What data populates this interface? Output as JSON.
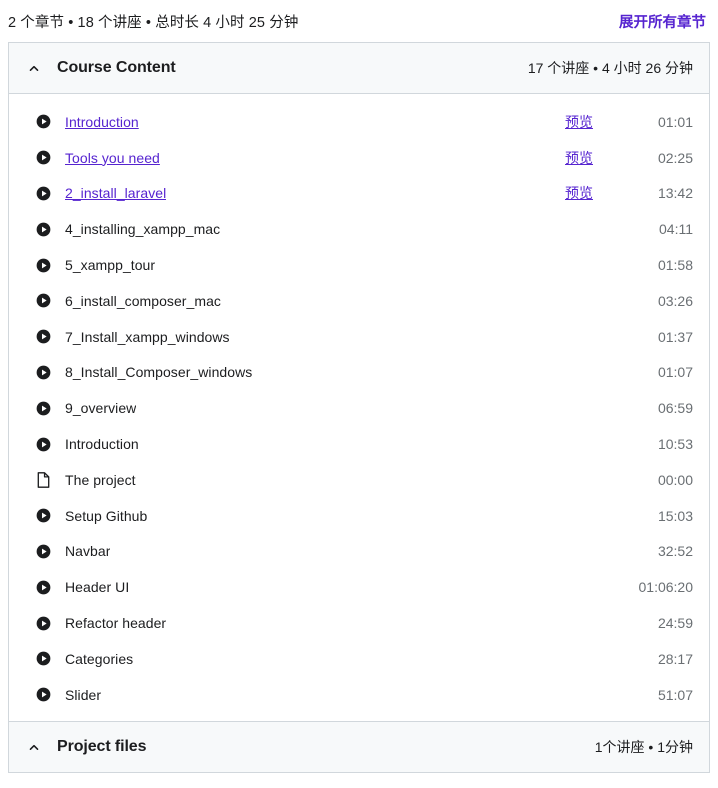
{
  "summary": {
    "text": "2 个章节 • 18 个讲座 • 总时长 4 小时 25 分钟",
    "expand_all_label": "展开所有章节"
  },
  "colors": {
    "link_purple": "#5624d0",
    "text_primary": "#1c1d1f",
    "text_muted": "#6a6f73",
    "header_bg": "#f7f9fa",
    "border": "#d1d7dc"
  },
  "sections": [
    {
      "title": "Course Content",
      "meta": "17 个讲座 • 4 小时 26 分钟",
      "expanded": true,
      "toggle_icon": "chevron-up-icon",
      "lectures": [
        {
          "title": "Introduction",
          "icon": "play-icon",
          "is_link": true,
          "preview": "预览",
          "duration": "01:01"
        },
        {
          "title": "Tools you need",
          "icon": "play-icon",
          "is_link": true,
          "preview": "预览",
          "duration": "02:25"
        },
        {
          "title": "2_install_laravel",
          "icon": "play-icon",
          "is_link": true,
          "preview": "预览",
          "duration": "13:42"
        },
        {
          "title": "4_installing_xampp_mac",
          "icon": "play-icon",
          "is_link": false,
          "preview": "",
          "duration": "04:11"
        },
        {
          "title": "5_xampp_tour",
          "icon": "play-icon",
          "is_link": false,
          "preview": "",
          "duration": "01:58"
        },
        {
          "title": "6_install_composer_mac",
          "icon": "play-icon",
          "is_link": false,
          "preview": "",
          "duration": "03:26"
        },
        {
          "title": "7_Install_xampp_windows",
          "icon": "play-icon",
          "is_link": false,
          "preview": "",
          "duration": "01:37"
        },
        {
          "title": "8_Install_Composer_windows",
          "icon": "play-icon",
          "is_link": false,
          "preview": "",
          "duration": "01:07"
        },
        {
          "title": "9_overview",
          "icon": "play-icon",
          "is_link": false,
          "preview": "",
          "duration": "06:59"
        },
        {
          "title": "Introduction",
          "icon": "play-icon",
          "is_link": false,
          "preview": "",
          "duration": "10:53"
        },
        {
          "title": "The project",
          "icon": "article-icon",
          "is_link": false,
          "preview": "",
          "duration": "00:00"
        },
        {
          "title": "Setup Github",
          "icon": "play-icon",
          "is_link": false,
          "preview": "",
          "duration": "15:03"
        },
        {
          "title": "Navbar",
          "icon": "play-icon",
          "is_link": false,
          "preview": "",
          "duration": "32:52"
        },
        {
          "title": "Header UI",
          "icon": "play-icon",
          "is_link": false,
          "preview": "",
          "duration": "01:06:20"
        },
        {
          "title": "Refactor header",
          "icon": "play-icon",
          "is_link": false,
          "preview": "",
          "duration": "24:59"
        },
        {
          "title": "Categories",
          "icon": "play-icon",
          "is_link": false,
          "preview": "",
          "duration": "28:17"
        },
        {
          "title": "Slider",
          "icon": "play-icon",
          "is_link": false,
          "preview": "",
          "duration": "51:07"
        }
      ]
    },
    {
      "title": "Project files",
      "meta": "1个讲座 • 1分钟",
      "expanded": true,
      "toggle_icon": "chevron-up-icon",
      "lectures": []
    }
  ]
}
